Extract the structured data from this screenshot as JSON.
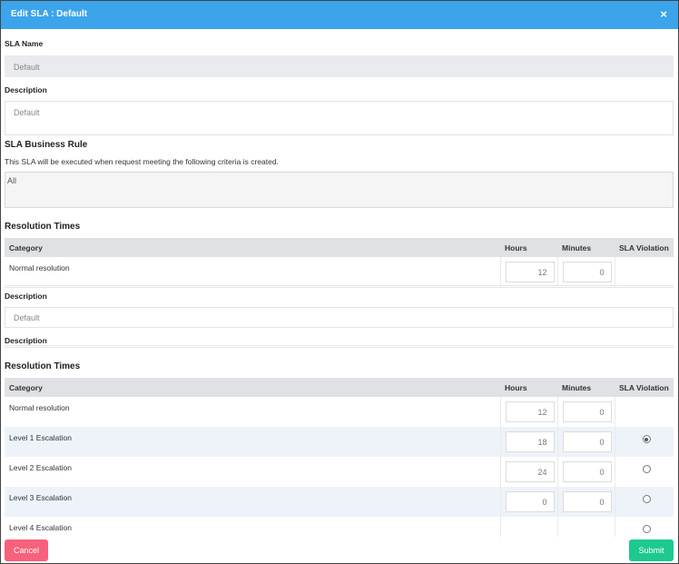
{
  "dialog": {
    "title": "Edit SLA :  Default",
    "close_symbol": "×",
    "sla_name_label": "SLA Name",
    "sla_name_value": "Default",
    "description_label": "Description",
    "description_value": "Default",
    "business_rule_title": "SLA Business Rule",
    "business_rule_text": "This SLA will be executed when request meeting the following criteria is created.",
    "business_rule_value": "All"
  },
  "resolution1": {
    "title": "Resolution Times",
    "headers": [
      "Category",
      "Hours",
      "Minutes",
      "SLA Violation"
    ],
    "rows": [
      {
        "category": "Normal resolution",
        "hours": "12",
        "minutes": "0"
      }
    ],
    "description_label": "Description",
    "description_value": "Default",
    "description2_label": "Description"
  },
  "resolution2": {
    "title": "Resolution Times",
    "headers": [
      "Category",
      "Hours",
      "Minutes",
      "SLA Violation"
    ],
    "rows": [
      {
        "category": "Normal resolution",
        "hours": "12",
        "minutes": "0",
        "radio": "none"
      },
      {
        "category": "Level 1 Escalation",
        "hours": "18",
        "minutes": "0",
        "radio": "checked"
      },
      {
        "category": "Level 2 Escalation",
        "hours": "24",
        "minutes": "0",
        "radio": "unchecked"
      },
      {
        "category": "Level 3 Escalation",
        "hours": "0",
        "minutes": "0",
        "radio": "unchecked"
      },
      {
        "category": "Level 4 Escalation",
        "hours": "",
        "minutes": "",
        "radio": "unchecked"
      }
    ]
  },
  "buttons": {
    "cancel": "Cancel",
    "submit": "Submit"
  },
  "colors": {
    "header": "#3ba4ea",
    "cancel": "#f6617b",
    "submit": "#1ec98f"
  }
}
